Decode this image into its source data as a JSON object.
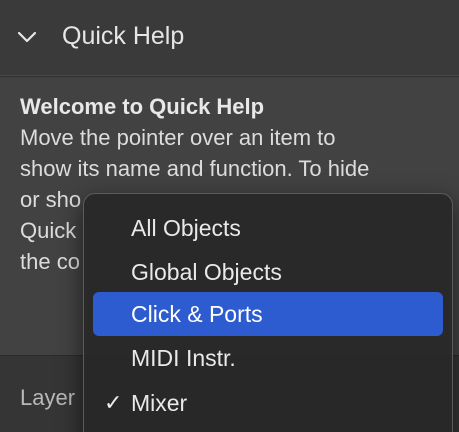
{
  "header": {
    "title": "Quick Help",
    "expand_icon": "chevron-down-icon"
  },
  "help": {
    "title": "Welcome to Quick Help",
    "lines": [
      "Move the pointer over an item to",
      "show its name and function. To hide",
      "or sho",
      "Quick",
      "the co"
    ]
  },
  "bottom": {
    "layer_label": "Layer"
  },
  "menu": {
    "items": [
      {
        "label": "All Objects",
        "checked": false,
        "highlighted": false
      },
      {
        "label": "Global Objects",
        "checked": false,
        "highlighted": false
      },
      {
        "label": "Click & Ports",
        "checked": false,
        "highlighted": true
      },
      {
        "label": "MIDI Instr.",
        "checked": false,
        "highlighted": false
      },
      {
        "label": "Mixer",
        "checked": true,
        "highlighted": false
      }
    ],
    "check_glyph": "✓"
  },
  "colors": {
    "highlight": "#2d5bd0",
    "panel": "#424242",
    "header": "#3a3a3a"
  }
}
